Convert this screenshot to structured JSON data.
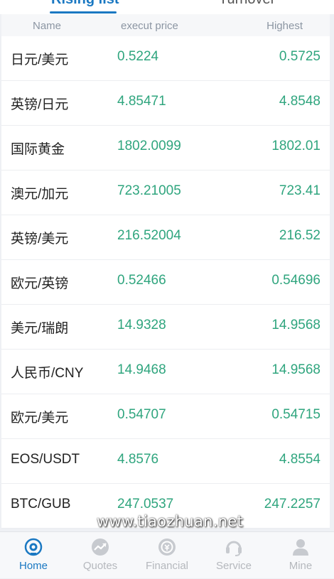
{
  "tabs": [
    {
      "label": "Rising list"
    },
    {
      "label": "Turnover"
    }
  ],
  "table": {
    "headers": {
      "name": "Name",
      "price": "execut price",
      "high": "Highest"
    },
    "rows": [
      {
        "name": "日元/美元",
        "price": "0.5224",
        "high": "0.5725"
      },
      {
        "name": "英镑/日元",
        "price": "4.85471",
        "high": "4.8548"
      },
      {
        "name": "国际黄金",
        "price": "1802.0099",
        "high": "1802.01"
      },
      {
        "name": "澳元/加元",
        "price": "723.21005",
        "high": "723.41"
      },
      {
        "name": "英镑/美元",
        "price": "216.52004",
        "high": "216.52"
      },
      {
        "name": "欧元/英镑",
        "price": "0.52466",
        "high": "0.54696"
      },
      {
        "name": "美元/瑞朗",
        "price": "14.9328",
        "high": "14.9568"
      },
      {
        "name": "人民币/CNY",
        "price": "14.9468",
        "high": "14.9568"
      },
      {
        "name": "欧元/美元",
        "price": "0.54707",
        "high": "0.54715"
      },
      {
        "name": "EOS/USDT",
        "price": "4.8576",
        "high": "4.8554"
      },
      {
        "name": "BTC/GUB",
        "price": "247.0537",
        "high": "247.2257"
      }
    ]
  },
  "watermark": "www.tiaozhuan.net",
  "nav": [
    {
      "label": "Home",
      "icon": "home-icon"
    },
    {
      "label": "Quotes",
      "icon": "chart-icon"
    },
    {
      "label": "Financial",
      "icon": "financial-icon"
    },
    {
      "label": "Service",
      "icon": "headset-icon"
    },
    {
      "label": "Mine",
      "icon": "user-icon"
    }
  ],
  "colors": {
    "accent": "#1a78c2",
    "up": "#2fa57e",
    "inactive": "#b5b8bd"
  }
}
